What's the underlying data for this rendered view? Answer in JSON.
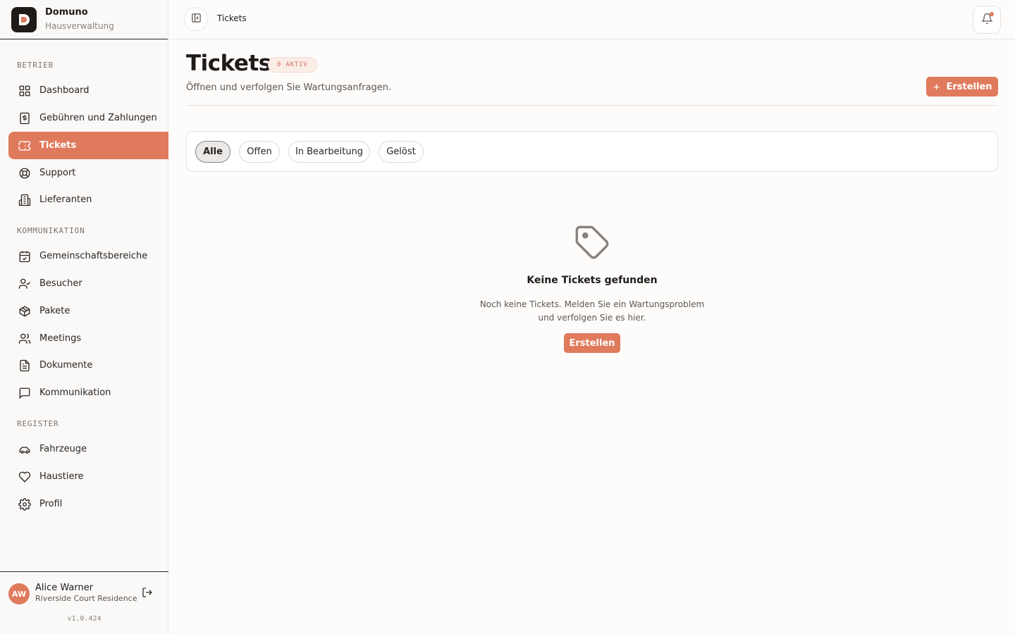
{
  "brand": {
    "name": "Domuno",
    "subtitle": "Hausverwaltung"
  },
  "sidebar": {
    "sections": [
      {
        "label": "BETRIEB",
        "items": [
          {
            "label": "Dashboard",
            "icon": "grid-icon"
          },
          {
            "label": "Gebühren und Zahlungen",
            "icon": "dollar-receipt-icon"
          },
          {
            "label": "Tickets",
            "icon": "ticket-icon",
            "active": true
          },
          {
            "label": "Support",
            "icon": "lifebuoy-icon"
          },
          {
            "label": "Lieferanten",
            "icon": "building-icon"
          }
        ]
      },
      {
        "label": "KOMMUNIKATION",
        "items": [
          {
            "label": "Gemeinschaftsbereiche",
            "icon": "calendar-check-icon"
          },
          {
            "label": "Besucher",
            "icon": "user-check-icon"
          },
          {
            "label": "Pakete",
            "icon": "package-icon"
          },
          {
            "label": "Meetings",
            "icon": "users-icon"
          },
          {
            "label": "Dokumente",
            "icon": "document-icon"
          },
          {
            "label": "Kommunikation",
            "icon": "message-square-icon"
          }
        ]
      },
      {
        "label": "REGISTER",
        "items": [
          {
            "label": "Fahrzeuge",
            "icon": "car-icon"
          },
          {
            "label": "Haustiere",
            "icon": "heart-icon"
          },
          {
            "label": "Profil",
            "icon": "gear-icon"
          }
        ]
      }
    ]
  },
  "user": {
    "initials": "AW",
    "name": "Alice Warner",
    "residence": "Riverside Court Residence"
  },
  "version": "v1.0.424",
  "topbar": {
    "breadcrumb": "Tickets",
    "has_notification": true
  },
  "page": {
    "title": "Tickets",
    "badge": "0 AKTIV",
    "subtitle": "Öffnen und verfolgen Sie Wartungsanfragen.",
    "create_label": "Erstellen"
  },
  "filters": [
    {
      "label": "Alle",
      "active": true
    },
    {
      "label": "Offen",
      "active": false
    },
    {
      "label": "In Bearbeitung",
      "active": false
    },
    {
      "label": "Gelöst",
      "active": false
    }
  ],
  "empty_state": {
    "title": "Keine Tickets gefunden",
    "text_line1": "Noch keine Tickets. Melden Sie ein Wartungsproblem",
    "text_line2": "und verfolgen Sie es hier.",
    "button_label": "Erstellen"
  },
  "colors": {
    "accent": "#e07a5c",
    "text": "#1f1b19",
    "muted": "#5d5651",
    "background": "#fdfcfb"
  }
}
